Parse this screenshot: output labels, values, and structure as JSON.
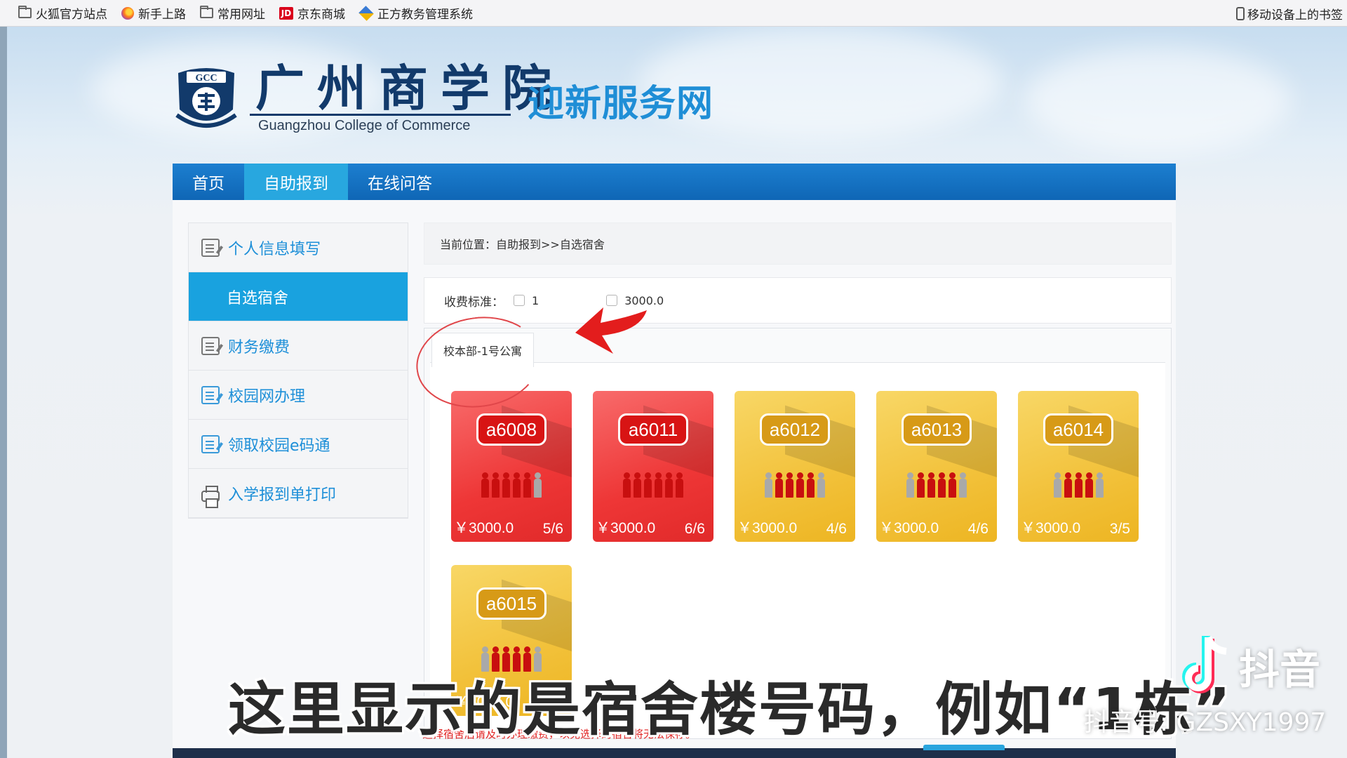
{
  "bookmarks": {
    "items": [
      {
        "label": "火狐官方站点",
        "icon": "folder-icon"
      },
      {
        "label": "新手上路",
        "icon": "firefox-icon"
      },
      {
        "label": "常用网址",
        "icon": "folder-icon"
      },
      {
        "label": "京东商城",
        "icon": "jd-icon",
        "icon_text": "JD"
      },
      {
        "label": "正方教务管理系统",
        "icon": "books-icon"
      }
    ],
    "right_label": "移动设备上的书签"
  },
  "header": {
    "emblem_text": "GCC",
    "college_cn": "广州商学院",
    "college_en": "Guangzhou College of Commerce",
    "site_name": "迎新服务网"
  },
  "nav": {
    "items": [
      {
        "label": "首页",
        "active": false
      },
      {
        "label": "自助报到",
        "active": true
      },
      {
        "label": "在线问答",
        "active": false
      }
    ]
  },
  "sidebar": {
    "items": [
      {
        "label": "个人信息填写",
        "icon": "edit-note-icon",
        "active": false
      },
      {
        "label": "自选宿舍",
        "icon": "",
        "active": true
      },
      {
        "label": "财务缴费",
        "icon": "edit-note-icon",
        "active": false
      },
      {
        "label": "校园网办理",
        "icon": "edit-note-icon",
        "active": false
      },
      {
        "label": "领取校园e码通",
        "icon": "edit-note-icon",
        "active": false
      },
      {
        "label": "入学报到单打印",
        "icon": "printer-icon",
        "active": false
      }
    ]
  },
  "main": {
    "breadcrumb": "当前位置：自助报到>>自选宿舍",
    "fee_label": "收费标准：",
    "fee_options": [
      "1",
      "3000.0"
    ],
    "building_tab": "校本部-1号公寓",
    "rooms": [
      {
        "id": "a6008",
        "price": "￥3000.0",
        "count": "5/6",
        "occupied": 5,
        "capacity": 6,
        "status": "full",
        "color": "#ee3636"
      },
      {
        "id": "a6011",
        "price": "￥3000.0",
        "count": "6/6",
        "occupied": 6,
        "capacity": 6,
        "status": "full",
        "color": "#ee3636"
      },
      {
        "id": "a6012",
        "price": "￥3000.0",
        "count": "4/6",
        "occupied": 4,
        "capacity": 6,
        "status": "available",
        "color": "#f2c13a"
      },
      {
        "id": "a6013",
        "price": "￥3000.0",
        "count": "4/6",
        "occupied": 4,
        "capacity": 6,
        "status": "available",
        "color": "#f2c13a"
      },
      {
        "id": "a6014",
        "price": "￥3000.0",
        "count": "3/5",
        "occupied": 3,
        "capacity": 5,
        "status": "available",
        "color": "#f2c13a"
      },
      {
        "id": "a6015",
        "price": "￥3000.0",
        "count": "4/6",
        "occupied": 4,
        "capacity": 6,
        "status": "available",
        "color": "#f2c13a"
      }
    ],
    "notice": "选择宿舍后请及时办理缴费，以免选择的宿舍将无法保存。"
  },
  "overlay": {
    "subtitle": "这里显示的是宿舍楼号码，例如“1栋”",
    "watermark_app": "抖音",
    "watermark_id": "抖音号: GZSXY1997"
  }
}
